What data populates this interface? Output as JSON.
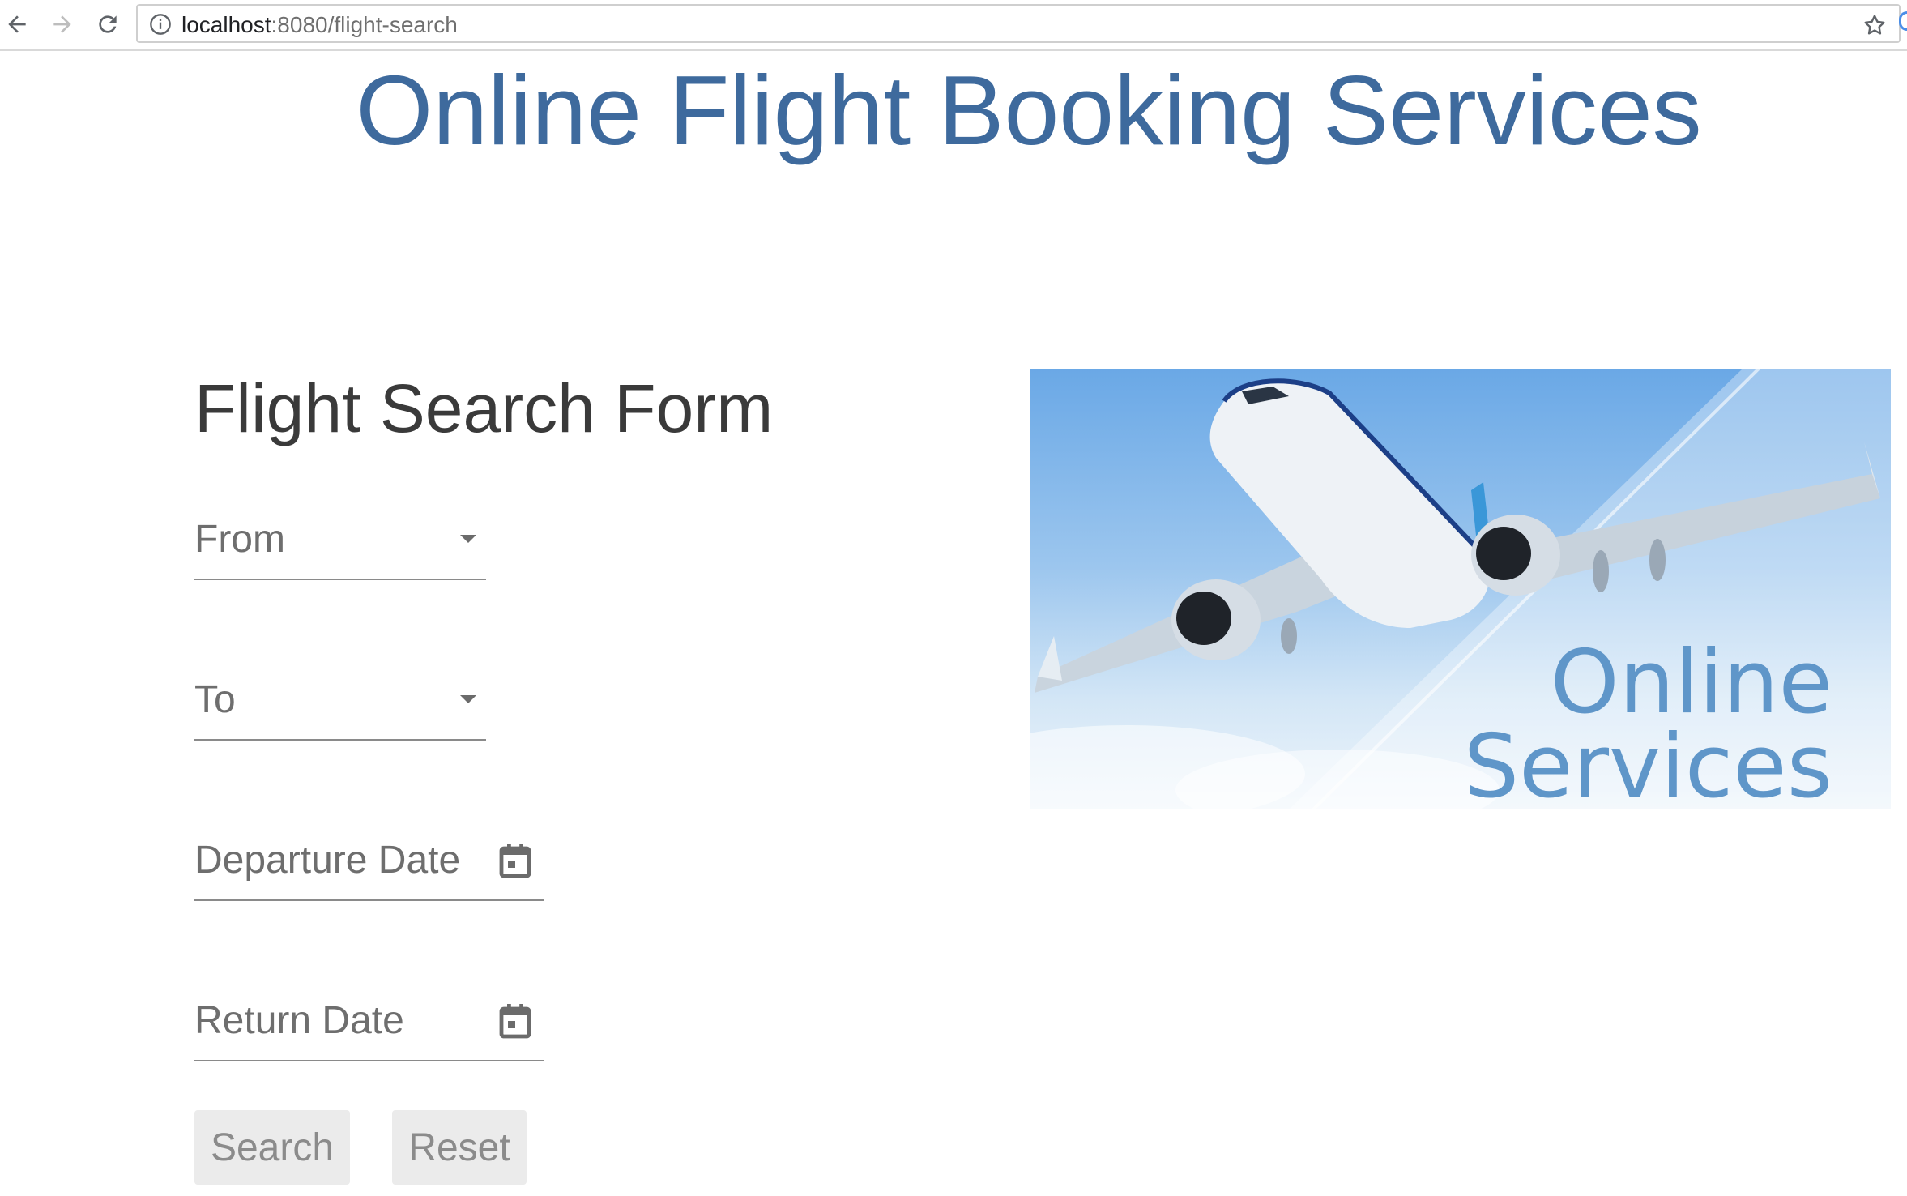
{
  "browser": {
    "url_host": "localhost",
    "url_path": ":8080/flight-search"
  },
  "page": {
    "site_title": "Online Flight Booking Services",
    "form_heading": "Flight Search Form"
  },
  "form": {
    "from_label": "From",
    "to_label": "To",
    "departure_label": "Departure Date",
    "return_label": "Return Date",
    "search_button": "Search",
    "reset_button": "Reset"
  },
  "hero": {
    "caption_line1": "Online",
    "caption_line2": "Services"
  },
  "colors": {
    "title_blue": "#3e6a9d",
    "button_bg": "#ebebeb",
    "caption_blue": "#5f96c9"
  }
}
